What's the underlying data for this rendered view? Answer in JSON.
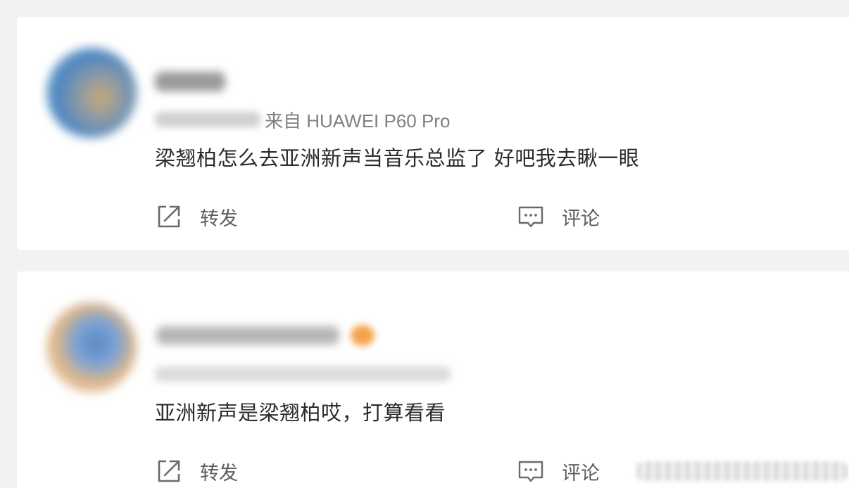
{
  "posts": [
    {
      "meta_source": "来自 HUAWEI P60 Pro",
      "text": "梁翘柏怎么去亚洲新声当音乐总监了 好吧我去瞅一眼",
      "actions": {
        "repost_label": "转发",
        "comment_label": "评论"
      }
    },
    {
      "meta_source": "",
      "text": "亚洲新声是梁翘柏哎，打算看看",
      "actions": {
        "repost_label": "转发",
        "comment_label": "评论"
      }
    }
  ],
  "icons": {
    "repost": "repost-icon",
    "comment": "comment-icon"
  },
  "colors": {
    "background": "#f2f2f2",
    "card": "#ffffff",
    "text": "#2b2b2b",
    "meta": "#808080",
    "action": "#5c5c5c"
  }
}
